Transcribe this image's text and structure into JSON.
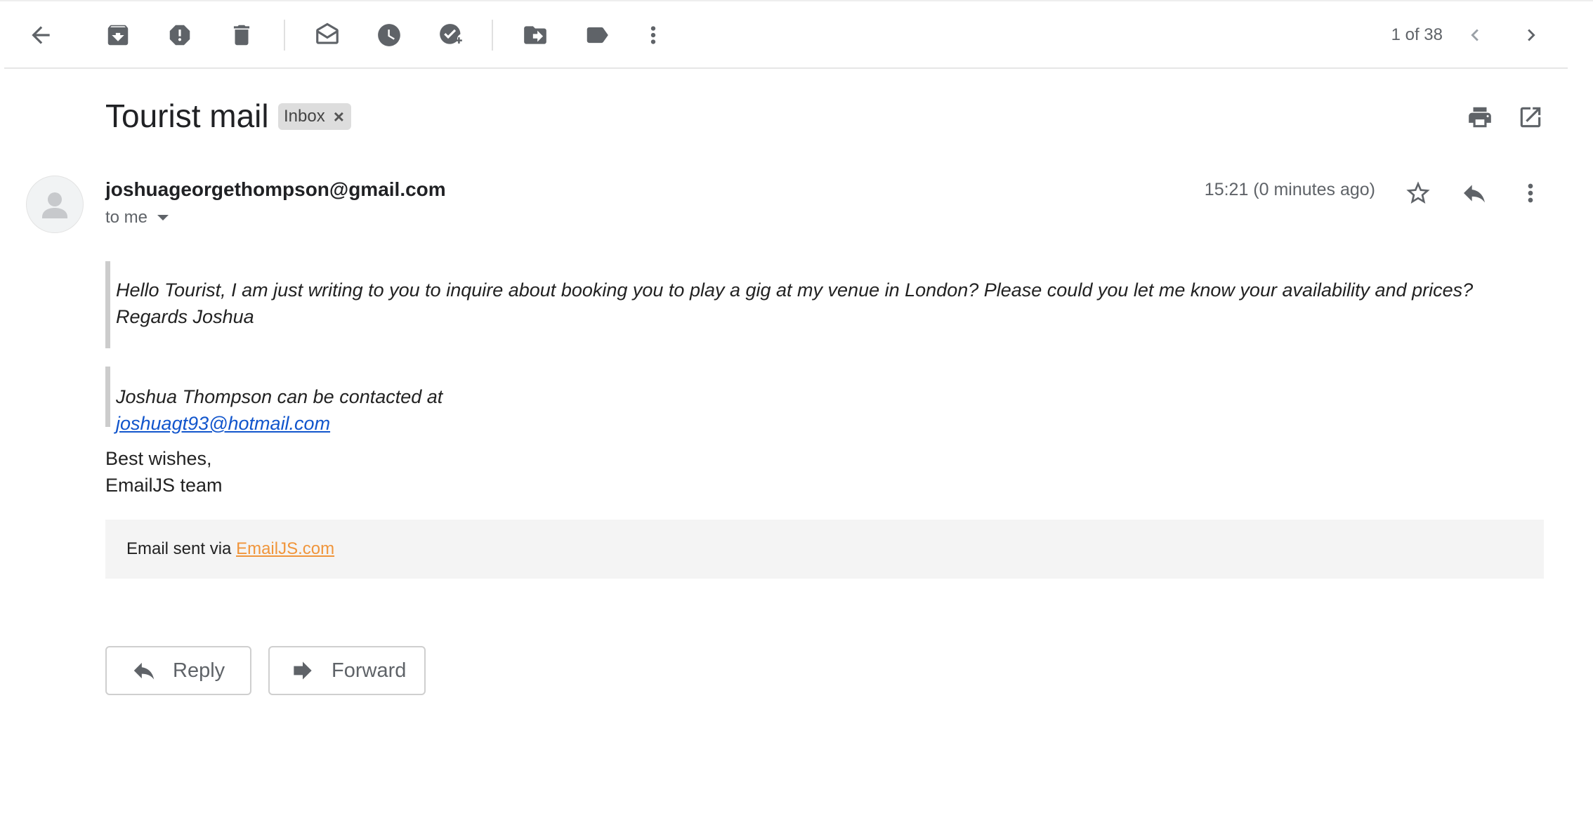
{
  "toolbar": {
    "icons": [
      "back-arrow-icon",
      "archive-icon",
      "report-spam-icon",
      "delete-icon",
      "mark-unread-icon",
      "snooze-icon",
      "add-to-tasks-icon",
      "move-to-icon",
      "label-icon",
      "more-vert-icon"
    ],
    "pager": "1 of 38"
  },
  "subject": {
    "title": "Tourist mail",
    "label": "Inbox",
    "label_remove": "×"
  },
  "message": {
    "sender": "joshuageorgethompson@gmail.com",
    "recipient": "to me",
    "time": "15:21 (0 minutes ago)",
    "quote1": "Hello Tourist, I am just writing to you to inquire about booking you to play a gig at my venue in London? Please could you let me know your availability and prices? Regards Joshua",
    "quote2_prefix": "Joshua Thompson can be contacted at ",
    "quote2_email": "joshuagt93@hotmail.com",
    "signoff_line1": "Best wishes,",
    "signoff_line2": "EmailJS team",
    "footer_prefix": "Email sent via ",
    "footer_link": "EmailJS.com"
  },
  "actions": {
    "reply": "Reply",
    "forward": "Forward"
  },
  "colors": {
    "link": "#1155cc",
    "footer_link": "#f0953b",
    "icon": "#5f6368"
  }
}
